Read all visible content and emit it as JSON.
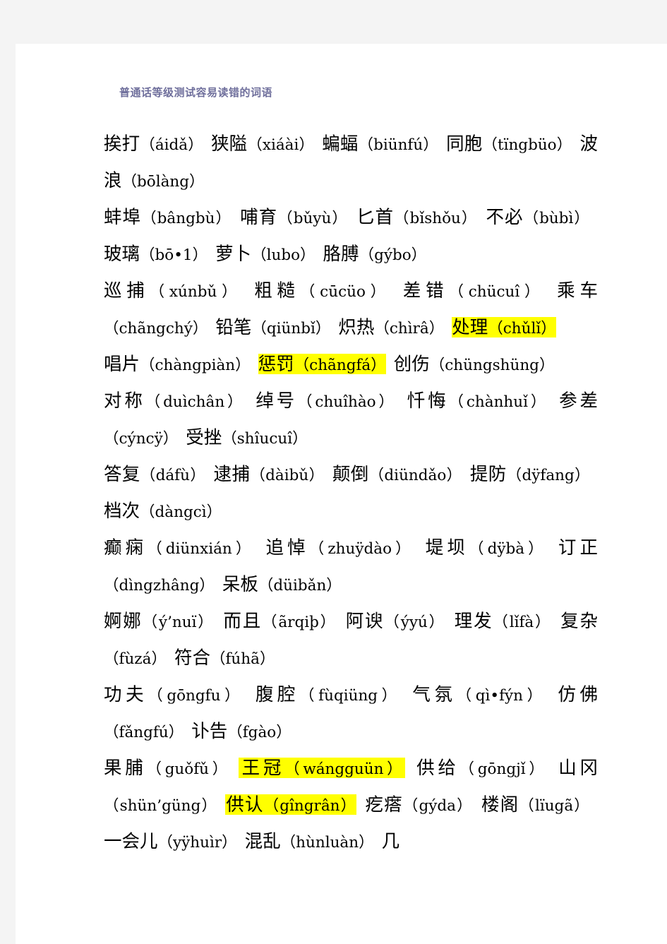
{
  "document": {
    "title": "普通话等级测试容易读错的词语",
    "title_color": "#6f6f9c",
    "highlight_color": "#ffff00",
    "page_background": "#ffffff",
    "canvas_background": "#f4f4f4",
    "paragraphs": [
      {
        "id": "p1",
        "runs": [
          {
            "text": "挨打（áidǎ）",
            "highlight": false
          },
          {
            "text": "狭隘（xiáài）",
            "highlight": false
          },
          {
            "text": "蝙蝠（biünfú）",
            "highlight": false
          },
          {
            "text": "同胞（tïngbüo）",
            "highlight": false
          },
          {
            "text": "波浪（bōlàng）",
            "highlight": false
          }
        ]
      },
      {
        "id": "p2",
        "runs": [
          {
            "text": "蚌埠（bângbù）",
            "highlight": false
          },
          {
            "text": "哺育（bǔyù）",
            "highlight": false
          },
          {
            "text": "匕首（bǐshǒu）",
            "highlight": false
          },
          {
            "text": "不必（bùbì）",
            "highlight": false
          },
          {
            "text": "玻璃（bō•1）",
            "highlight": false
          },
          {
            "text": "萝卜（lubo）",
            "highlight": false
          },
          {
            "text": "胳膊（gýbo）",
            "highlight": false
          }
        ]
      },
      {
        "id": "p3",
        "runs": [
          {
            "text": "巡捕（xúnbǔ）",
            "highlight": false
          },
          {
            "text": "粗糙（cūcüo）",
            "highlight": false
          },
          {
            "text": "差错（chücuî）",
            "highlight": false
          },
          {
            "text": "乘车（chãngchý）",
            "highlight": false
          },
          {
            "text": "铅笔（qiünbǐ）",
            "highlight": false
          },
          {
            "text": "炽热（chìrâ）",
            "highlight": false
          },
          {
            "text": "处理（chǔlǐ）",
            "highlight": true
          }
        ]
      },
      {
        "id": "p4",
        "runs": [
          {
            "text": "唱片（chàngpiàn）",
            "highlight": false
          },
          {
            "text": "惩罚（chãngfá）",
            "highlight": true
          },
          {
            "text": "创伤（chüngshüng）",
            "highlight": false
          }
        ]
      },
      {
        "id": "p5",
        "runs": [
          {
            "text": "对称（duìchân）",
            "highlight": false
          },
          {
            "text": "绰号（chuîhào）",
            "highlight": false
          },
          {
            "text": "忏悔（chànhuǐ）",
            "highlight": false
          },
          {
            "text": "参差（cýncÿ）",
            "highlight": false
          },
          {
            "text": "受挫（shîucuî）",
            "highlight": false
          }
        ]
      },
      {
        "id": "p6",
        "runs": [
          {
            "text": "答复（dáfù）",
            "highlight": false
          },
          {
            "text": "逮捕（dàibǔ）",
            "highlight": false
          },
          {
            "text": "颠倒（diündǎo）",
            "highlight": false
          },
          {
            "text": "提防（dÿfang）",
            "highlight": false
          },
          {
            "text": "档次（dàngcì）",
            "highlight": false
          }
        ]
      },
      {
        "id": "p7",
        "runs": [
          {
            "text": "癫痫（diünxián）",
            "highlight": false
          },
          {
            "text": "追悼（zhuÿdào）",
            "highlight": false
          },
          {
            "text": "堤坝（dÿbà）",
            "highlight": false
          },
          {
            "text": "订正（dìngzhâng）",
            "highlight": false
          },
          {
            "text": "呆板（düibǎn）",
            "highlight": false
          }
        ]
      },
      {
        "id": "p8",
        "runs": [
          {
            "text": "婀娜（ý’nuï）",
            "highlight": false
          },
          {
            "text": "而且（ãrqiþ）",
            "highlight": false
          },
          {
            "text": "阿谀（ýyú）",
            "highlight": false
          },
          {
            "text": "理发（lǐfà）",
            "highlight": false
          },
          {
            "text": "复杂（fùzá）",
            "highlight": false
          },
          {
            "text": "符合（fúhã）",
            "highlight": false
          }
        ]
      },
      {
        "id": "p9",
        "runs": [
          {
            "text": "功夫（gōngfu）",
            "highlight": false
          },
          {
            "text": "腹腔（fùqiüng）",
            "highlight": false
          },
          {
            "text": "气氛（qì•fýn）",
            "highlight": false
          },
          {
            "text": "仿佛（fǎngfú）",
            "highlight": false
          },
          {
            "text": "讣告（fgào）",
            "highlight": false
          }
        ]
      },
      {
        "id": "p10",
        "runs": [
          {
            "text": "果脯（guǒfǔ）",
            "highlight": false
          },
          {
            "text": "王冠（wángguün）",
            "highlight": true
          },
          {
            "text": "供给（gōngjǐ）",
            "highlight": false
          },
          {
            "text": "山冈（shün’güng）",
            "highlight": false
          },
          {
            "text": "供认（gîngrân）",
            "highlight": true
          },
          {
            "text": "疙瘩（gýda）",
            "highlight": false
          },
          {
            "text": "楼阁（lïugã）",
            "highlight": false
          },
          {
            "text": "一会儿（yÿhuìr）",
            "highlight": false
          },
          {
            "text": "混乱（hùnluàn）",
            "highlight": false
          },
          {
            "text": "几",
            "highlight": false
          }
        ]
      }
    ]
  }
}
